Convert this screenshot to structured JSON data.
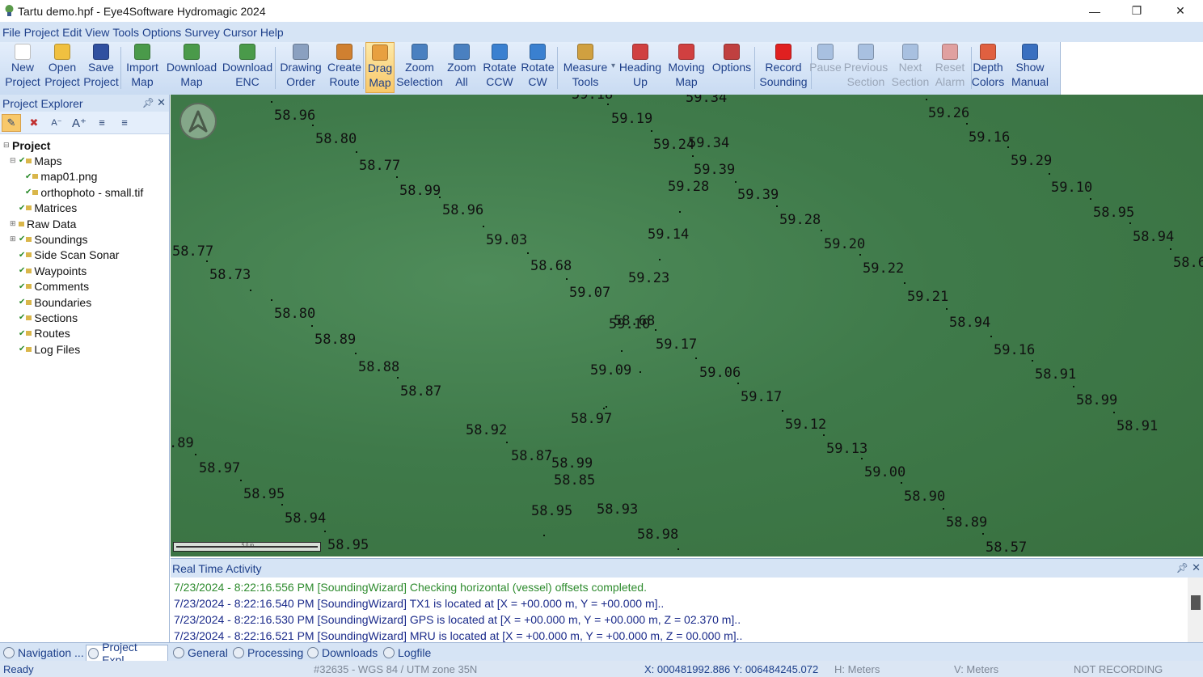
{
  "window": {
    "title": "Tartu demo.hpf - Eye4Software Hydromagic 2024",
    "controls": {
      "minimize": "—",
      "restore": "❐",
      "close": "✕"
    }
  },
  "menu": [
    "File",
    "Project",
    "Edit",
    "View",
    "Tools",
    "Options",
    "Survey",
    "Cursor",
    "Help"
  ],
  "toolbar": [
    {
      "line1": "New",
      "line2": "Project",
      "icon": "new-file-icon",
      "color": "#ffffff",
      "enabled": true
    },
    {
      "line1": "Open",
      "line2": "Project",
      "icon": "open-folder-icon",
      "color": "#f0c040",
      "enabled": true
    },
    {
      "line1": "Save",
      "line2": "Project",
      "icon": "floppy-disk-icon",
      "color": "#3050a0",
      "enabled": true
    },
    {
      "line1": "Import",
      "line2": "Map",
      "icon": "import-map-icon",
      "color": "#4a9a4a",
      "enabled": true
    },
    {
      "line1": "Download",
      "line2": "Map",
      "icon": "download-map-icon",
      "color": "#4a9a4a",
      "enabled": true
    },
    {
      "line1": "Download",
      "line2": "ENC",
      "icon": "download-enc-icon",
      "color": "#4a9a4a",
      "enabled": true
    },
    {
      "line1": "Drawing",
      "line2": "Order",
      "icon": "drawing-order-icon",
      "color": "#8aa0c0",
      "enabled": true
    },
    {
      "line1": "Create",
      "line2": "Route",
      "icon": "create-route-icon",
      "color": "#d08030",
      "enabled": true
    },
    {
      "line1": "Drag",
      "line2": "Map",
      "icon": "hand-icon",
      "color": "#e8a040",
      "enabled": true,
      "active": true
    },
    {
      "line1": "Zoom",
      "line2": "Selection",
      "icon": "zoom-selection-icon",
      "color": "#4a80c0",
      "enabled": true
    },
    {
      "line1": "Zoom",
      "line2": "All",
      "icon": "zoom-all-icon",
      "color": "#4a80c0",
      "enabled": true
    },
    {
      "line1": "Rotate",
      "line2": "CCW",
      "icon": "rotate-ccw-icon",
      "color": "#3a80d0",
      "enabled": true
    },
    {
      "line1": "Rotate",
      "line2": "CW",
      "icon": "rotate-cw-icon",
      "color": "#3a80d0",
      "enabled": true
    },
    {
      "line1": "Measure",
      "line2": "Tools",
      "icon": "measure-triangle-icon",
      "color": "#d0a040",
      "enabled": true,
      "dropdown": true
    },
    {
      "line1": "Heading",
      "line2": "Up",
      "icon": "heading-up-icon",
      "color": "#d04040",
      "enabled": true
    },
    {
      "line1": "Moving",
      "line2": "Map",
      "icon": "moving-map-icon",
      "color": "#d04040",
      "enabled": true
    },
    {
      "line1": "Options",
      "line2": "",
      "icon": "tools-icon",
      "color": "#c04040",
      "enabled": true
    },
    {
      "line1": "Record",
      "line2": "Sounding",
      "icon": "record-icon",
      "color": "#e02020",
      "enabled": true
    },
    {
      "line1": "Pause",
      "line2": "",
      "icon": "pause-icon",
      "color": "#a8c0e0",
      "enabled": false
    },
    {
      "line1": "Previous",
      "line2": "Section",
      "icon": "previous-section-icon",
      "color": "#a8c0e0",
      "enabled": false
    },
    {
      "line1": "Next",
      "line2": "Section",
      "icon": "next-section-icon",
      "color": "#a8c0e0",
      "enabled": false
    },
    {
      "line1": "Reset",
      "line2": "Alarm",
      "icon": "reset-alarm-icon",
      "color": "#e0a0a0",
      "enabled": false
    },
    {
      "line1": "Depth",
      "line2": "Colors",
      "icon": "color-wheel-icon",
      "color": "#e06040",
      "enabled": true
    },
    {
      "line1": "Show",
      "line2": "Manual",
      "icon": "manual-icon",
      "color": "#3a70c0",
      "enabled": true
    }
  ],
  "explorer": {
    "title": "Project Explorer",
    "tree": [
      {
        "label": "Project",
        "level": 0,
        "bold": true,
        "expander": "⊟",
        "check": false
      },
      {
        "label": "Maps",
        "level": 1,
        "expander": "⊟",
        "check": true
      },
      {
        "label": "map01.png",
        "level": 2,
        "expander": "",
        "check": true
      },
      {
        "label": "orthophoto - small.tif",
        "level": 2,
        "expander": "",
        "check": true
      },
      {
        "label": "Matrices",
        "level": 1,
        "expander": "",
        "check": true
      },
      {
        "label": "Raw Data",
        "level": 1,
        "expander": "⊞",
        "check": false
      },
      {
        "label": "Soundings",
        "level": 1,
        "expander": "⊞",
        "check": true
      },
      {
        "label": "Side Scan Sonar",
        "level": 1,
        "expander": "",
        "check": true
      },
      {
        "label": "Waypoints",
        "level": 1,
        "expander": "",
        "check": true
      },
      {
        "label": "Comments",
        "level": 1,
        "expander": "",
        "check": true
      },
      {
        "label": "Boundaries",
        "level": 1,
        "expander": "",
        "check": true
      },
      {
        "label": "Sections",
        "level": 1,
        "expander": "",
        "check": true
      },
      {
        "label": "Routes",
        "level": 1,
        "expander": "",
        "check": true
      },
      {
        "label": "Log Files",
        "level": 1,
        "expander": "",
        "check": true
      }
    ]
  },
  "map": {
    "compass_letter": "A",
    "scale_label": "5.0 m",
    "soundings": [
      "58.96",
      "58.80",
      "58.77",
      "58.99",
      "58.96",
      "59.03",
      "58.68",
      "59.07",
      "59.18",
      "59.19",
      "59.24",
      "59.34",
      "59.34",
      "59.39",
      "59.28",
      "59.39",
      "59.28",
      "59.20",
      "59.22",
      "59.21",
      "59.14",
      "59.23",
      "58.68",
      "59.10",
      "59.17",
      "59.06",
      "59.09",
      "59.17",
      "59.12",
      "58.97",
      "58.92",
      "58.87",
      "58.99",
      "58.85",
      "58.95",
      "58.93",
      "58.98",
      "59.13",
      "59.00",
      "58.90",
      "58.89",
      "58.57",
      "59.26",
      "59.16",
      "59.29",
      "59.10",
      "58.95",
      "58.94",
      "58.6",
      "58.94",
      "59.16",
      "58.91",
      "58.99",
      "58.91",
      "58.77",
      "58.73",
      "58.80",
      "58.89",
      "58.88",
      "58.87",
      ".89",
      "58.97",
      "58.95",
      "58.94",
      "58.95"
    ]
  },
  "rta": {
    "title": "Real Time Activity",
    "lines": [
      {
        "text": "7/23/2024 - 8:22:16.556 PM [SoundingWizard] Checking horizontal (vessel) offsets completed.",
        "color": "#2e8b2e"
      },
      {
        "text": "7/23/2024 - 8:22:16.540 PM [SoundingWizard] TX1 is located at [X = +00.000 m, Y = +00.000 m]..",
        "color": "#1a2a8a"
      },
      {
        "text": "7/23/2024 - 8:22:16.530 PM [SoundingWizard] GPS is located at [X = +00.000 m, Y = +00.000 m, Z = 02.370 m]..",
        "color": "#1a2a8a"
      },
      {
        "text": "7/23/2024 - 8:22:16.521 PM [SoundingWizard] MRU is located at [X = +00.000 m, Y = +00.000 m, Z = 00.000 m]..",
        "color": "#1a2a8a"
      }
    ]
  },
  "tabs": [
    {
      "label": "Navigation ...",
      "icon": "compass-icon"
    },
    {
      "label": "Project Expl...",
      "icon": "project-icon",
      "active": true
    },
    {
      "label": "General",
      "icon": "general-icon"
    },
    {
      "label": "Processing",
      "icon": "processing-icon"
    },
    {
      "label": "Downloads",
      "icon": "downloads-icon"
    },
    {
      "label": "Logfile",
      "icon": "logfile-icon"
    }
  ],
  "status": {
    "ready": "Ready",
    "crs": "#32635 - WGS 84 / UTM zone 35N",
    "coords": "X: 000481992.886  Y: 006484245.072",
    "h_units": "H: Meters",
    "v_units": "V: Meters",
    "recording": "NOT RECORDING"
  }
}
